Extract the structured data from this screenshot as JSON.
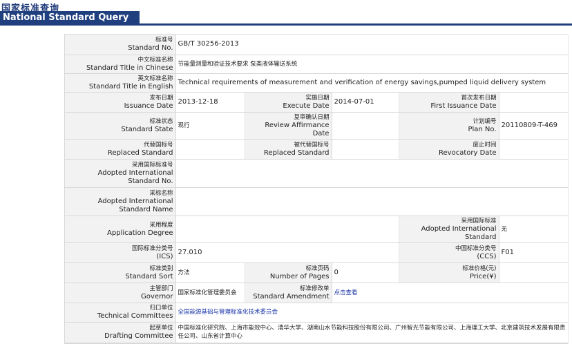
{
  "header": {
    "title_cn": "国家标准查询",
    "title_en": "National Standard Query"
  },
  "fields": {
    "std_no": {
      "label_cn": "标准号",
      "label_en": "Standard No.",
      "value": "GB/T 30256-2013"
    },
    "title_cn": {
      "label_cn": "中文标准名称",
      "label_en": "Standard Title in Chinese",
      "value": "节能量测量和验证技术要求 泵类液体输送系统"
    },
    "title_en": {
      "label_cn": "英文标准名称",
      "label_en": "Standard Title in English",
      "value": "Technical requirements of measurement and verification of energy savings,pumped liquid delivery system"
    },
    "issuance": {
      "label_cn": "发布日期",
      "label_en": "Issuance Date",
      "value": "2013-12-18"
    },
    "execute": {
      "label_cn": "实施日期",
      "label_en": "Execute Date",
      "value": "2014-07-01"
    },
    "first_issuance": {
      "label_cn": "首次发布日期",
      "label_en": "First Issuance Date",
      "value": ""
    },
    "state": {
      "label_cn": "标准状态",
      "label_en": "Standard State",
      "value": "现行"
    },
    "review": {
      "label_cn": "复审确认日期",
      "label_en": "Review Affirmance Date",
      "value": ""
    },
    "plan": {
      "label_cn": "计划编号",
      "label_en": "Plan No.",
      "value": "20110809-T-469"
    },
    "replaced": {
      "label_cn": "代替国标号",
      "label_en": "Replaced Standard",
      "value": ""
    },
    "revocatory_std": {
      "label_cn": "被代替国标号",
      "label_en": "Replaced Standard",
      "value": ""
    },
    "revocatory_date": {
      "label_cn": "废止时间",
      "label_en": "Revocatory Date",
      "value": ""
    },
    "adopted_no": {
      "label_cn": "采用国际标准号",
      "label_en": "Adopted International Standard No.",
      "value": ""
    },
    "adopted_name": {
      "label_cn": "采标名称",
      "label_en": "Adopted International Standard Name",
      "value": ""
    },
    "app_degree": {
      "label_cn": "采用程度",
      "label_en": "Application Degree",
      "value": ""
    },
    "adopted_std": {
      "label_cn": "采用国际标准",
      "label_en": "Adopted International Standard",
      "value": "无"
    },
    "ics": {
      "label_cn": "国际标准分类号",
      "label_en": "(ICS)",
      "value": "27.010"
    },
    "ccs": {
      "label_cn": "中国标准分类号",
      "label_en": "(CCS)",
      "value": "F01"
    },
    "sort": {
      "label_cn": "标准类别",
      "label_en": "Standard Sort",
      "value": "方法"
    },
    "pages": {
      "label_cn": "标准页码",
      "label_en": "Number of Pages",
      "value": "0"
    },
    "price": {
      "label_cn": "标准价格(元)",
      "label_en": "Price(¥)",
      "value": ""
    },
    "governor": {
      "label_cn": "主管部门",
      "label_en": "Governor",
      "value": "国家标准化管理委员会"
    },
    "amendment": {
      "label_cn": "标准修改单",
      "label_en": "Standard Amendment",
      "value": "点击查看"
    },
    "tech_committee": {
      "label_cn": "归口单位",
      "label_en": "Technical Committees",
      "value": "全国能源基础与管理标准化技术委员会"
    },
    "drafting": {
      "label_cn": "起草单位",
      "label_en": "Drafting Committee",
      "value": "中国标准化研究院、上海市能效中心、清华大学、湖南山水节能科技股份有限公司、广州智光节能有限公司、上海理工大学、北京建筑技术发展有限责任公司、山东省计算中心"
    }
  }
}
